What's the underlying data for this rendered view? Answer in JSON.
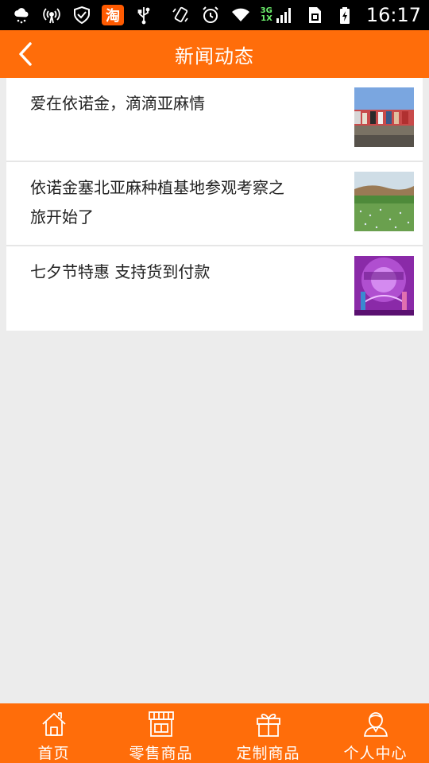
{
  "status_bar": {
    "taobao_glyph": "淘",
    "network_type_top": "3G",
    "network_type_bottom": "1X",
    "time": "16:17",
    "icons": [
      "cloud-rain-icon",
      "hotspot-icon",
      "shield-check-icon",
      "taobao-icon",
      "usb-icon",
      "rotate-icon",
      "alarm-icon",
      "wifi-icon",
      "signal-icon",
      "sim-icon",
      "battery-charging-icon"
    ]
  },
  "header": {
    "title": "新闻动态",
    "back_icon": "chevron-left-icon"
  },
  "news": [
    {
      "title": "爱在依诺金，滴滴亚麻情",
      "thumb": "group-photo"
    },
    {
      "title": "依诺金塞北亚麻种植基地参观考察之旅开始了",
      "thumb": "flax-field"
    },
    {
      "title": "七夕节特惠 支持货到付款",
      "thumb": "qixi-promo"
    }
  ],
  "bottom_nav": [
    {
      "label": "首页",
      "icon": "home-icon"
    },
    {
      "label": "零售商品",
      "icon": "store-icon"
    },
    {
      "label": "定制商品",
      "icon": "gift-icon"
    },
    {
      "label": "个人中心",
      "icon": "user-icon"
    }
  ],
  "colors": {
    "accent": "#ff6d0a",
    "background": "#ececec",
    "status_bar": "#000000"
  }
}
